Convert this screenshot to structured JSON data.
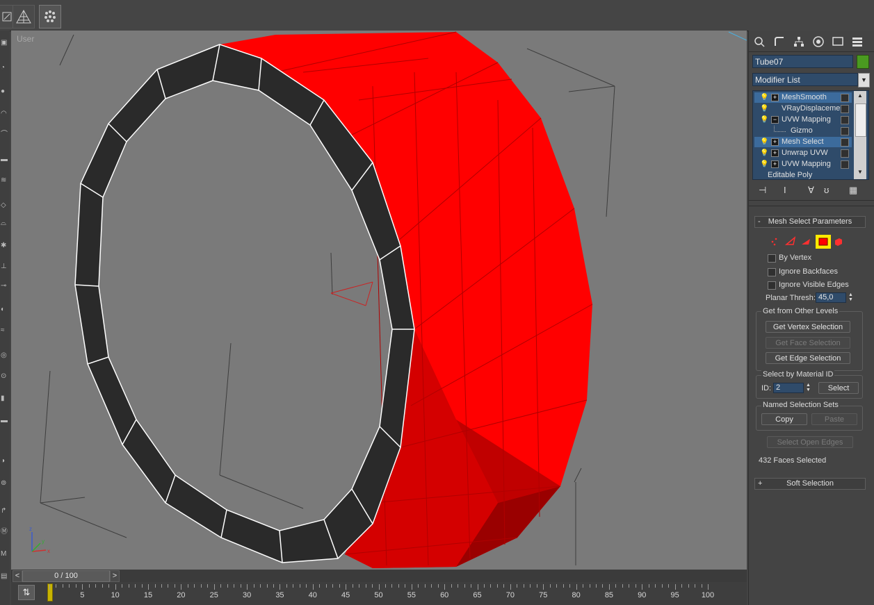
{
  "window": {
    "title": ""
  },
  "viewport": {
    "label": "User",
    "object_color": "#ff0000",
    "background_color": "#7a7a7a"
  },
  "top_toolbar": {
    "buttons": [
      {
        "name": "edit-icon"
      },
      {
        "name": "grid-snap-icon"
      },
      {
        "name": "particle-icon"
      }
    ]
  },
  "command_panel": {
    "tabs": [
      "create-icon",
      "modify-icon",
      "hierarchy-icon",
      "motion-icon",
      "display-icon",
      "utilities-icon"
    ],
    "object_name": "Tube07",
    "object_color": "#4a9a20",
    "modifier_list": "Modifier List",
    "stack": [
      {
        "label": "MeshSmooth",
        "expand": "+",
        "selected": true
      },
      {
        "label": "VRayDisplaceme",
        "expand": "",
        "selected": false
      },
      {
        "label": "UVW Mapping",
        "expand": "−",
        "selected": false
      },
      {
        "label": "Gizmo",
        "expand": "",
        "selected": false,
        "child": true
      },
      {
        "label": "Mesh Select",
        "expand": "+",
        "selected": true
      },
      {
        "label": "Unwrap UVW",
        "expand": "+",
        "selected": false
      },
      {
        "label": "UVW Mapping",
        "expand": "+",
        "selected": false
      },
      {
        "label": "Editable Poly",
        "expand": "",
        "selected": false
      }
    ],
    "rollout_mesh_select": {
      "title": "Mesh Select Parameters",
      "collapse": "-",
      "by_vertex": "By Vertex",
      "ignore_backfaces": "Ignore Backfaces",
      "ignore_visible_edges": "Ignore Visible Edges",
      "planar_thresh_label": "Planar Thresh:",
      "planar_thresh_value": "45,0",
      "get_from_other_levels": "Get from Other Levels",
      "get_vertex_selection": "Get Vertex Selection",
      "get_face_selection": "Get Face Selection",
      "get_edge_selection": "Get Edge Selection",
      "select_by_material_id": "Select by Material ID",
      "id_label": "ID:",
      "id_value": "2",
      "select_button": "Select",
      "named_selection_sets": "Named Selection Sets",
      "copy_button": "Copy",
      "paste_button": "Paste",
      "select_open_edges": "Select Open Edges",
      "status": "432 Faces Selected"
    },
    "rollout_soft_selection": {
      "title": "Soft Selection",
      "expand": "+"
    }
  },
  "timeline": {
    "frame_display": "0 / 100",
    "prev": "<",
    "next": ">",
    "ticks": [
      "5",
      "10",
      "15",
      "20",
      "25",
      "30",
      "35",
      "40",
      "45",
      "50",
      "55",
      "60",
      "65",
      "70",
      "75",
      "80",
      "85",
      "90",
      "95",
      "100"
    ],
    "current_frame": "0"
  }
}
